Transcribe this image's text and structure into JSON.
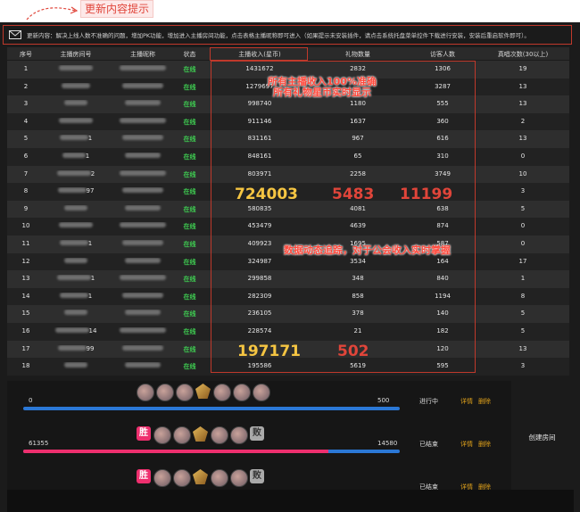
{
  "annotations": {
    "update_hint": "更新内容提示",
    "income_note_line1": "所有主播收入100%准确",
    "income_note_line2": "所有礼物星币实时显示",
    "data_note": "数据动态追踪，对于公会收入实时掌握"
  },
  "notice": {
    "text": "更新内容：解决上线人数不准确的问题，增加PK功能，增加进入主播房间功能，点击表格主播昵称即可进入（如果提示未安装插件，请点击系统托盘菜单控件下载进行安装，安装后重启软件即可）。"
  },
  "table": {
    "headers": [
      "序号",
      "主播房间号",
      "主播昵称",
      "状态",
      "主播收入(星币)",
      "礼物数量",
      "访客人数",
      "真唱次数(30以上)"
    ],
    "rows": [
      {
        "no": "1",
        "room": "",
        "nick": "",
        "status": "在线",
        "income": "1431672",
        "gifts": "2832",
        "visitors": "1306",
        "sing": "19"
      },
      {
        "no": "2",
        "room": "",
        "nick": "",
        "status": "在线",
        "income": "1279697",
        "gifts": "",
        "visitors": "3287",
        "sing": "13"
      },
      {
        "no": "3",
        "room": "",
        "nick": "",
        "status": "在线",
        "income": "998740",
        "gifts": "1180",
        "visitors": "555",
        "sing": "13"
      },
      {
        "no": "4",
        "room": "",
        "nick": "",
        "status": "在线",
        "income": "911146",
        "gifts": "1637",
        "visitors": "360",
        "sing": "2"
      },
      {
        "no": "5",
        "room": "1",
        "nick": "",
        "status": "在线",
        "income": "831161",
        "gifts": "967",
        "visitors": "616",
        "sing": "13"
      },
      {
        "no": "6",
        "room": "1",
        "nick": "",
        "status": "在线",
        "income": "848161",
        "gifts": "65",
        "visitors": "310",
        "sing": "0"
      },
      {
        "no": "7",
        "room": "2",
        "nick": "",
        "status": "在线",
        "income": "803971",
        "gifts": "2258",
        "visitors": "3749",
        "sing": "10"
      },
      {
        "no": "8",
        "room": "97",
        "nick": "",
        "status": "在线",
        "income": "",
        "gifts": "",
        "visitors": "",
        "sing": "3"
      },
      {
        "no": "9",
        "room": "",
        "nick": "",
        "status": "在线",
        "income": "580835",
        "gifts": "4081",
        "visitors": "638",
        "sing": "5"
      },
      {
        "no": "10",
        "room": "",
        "nick": "",
        "status": "在线",
        "income": "453479",
        "gifts": "4639",
        "visitors": "874",
        "sing": "0"
      },
      {
        "no": "11",
        "room": "1",
        "nick": "",
        "status": "在线",
        "income": "409923",
        "gifts": "1695",
        "visitors": "587",
        "sing": "0"
      },
      {
        "no": "12",
        "room": "",
        "nick": "",
        "status": "在线",
        "income": "324987",
        "gifts": "3534",
        "visitors": "164",
        "sing": "17"
      },
      {
        "no": "13",
        "room": "1",
        "nick": "",
        "status": "在线",
        "income": "299858",
        "gifts": "348",
        "visitors": "840",
        "sing": "1"
      },
      {
        "no": "14",
        "room": "1",
        "nick": "",
        "status": "在线",
        "income": "282309",
        "gifts": "858",
        "visitors": "1194",
        "sing": "8"
      },
      {
        "no": "15",
        "room": "",
        "nick": "",
        "status": "在线",
        "income": "236105",
        "gifts": "378",
        "visitors": "140",
        "sing": "5"
      },
      {
        "no": "16",
        "room": "14",
        "nick": "",
        "status": "在线",
        "income": "228574",
        "gifts": "21",
        "visitors": "182",
        "sing": "5"
      },
      {
        "no": "17",
        "room": "99",
        "nick": "",
        "status": "在线",
        "income": "",
        "gifts": "",
        "visitors": "120",
        "sing": "13"
      },
      {
        "no": "18",
        "room": "",
        "nick": "",
        "status": "在线",
        "income": "195586",
        "gifts": "5619",
        "visitors": "595",
        "sing": "3"
      }
    ],
    "highlight_row8": {
      "income": "724003",
      "gifts": "5483",
      "visitors": "11199"
    },
    "highlight_row17": {
      "income": "197171",
      "gifts": "502"
    }
  },
  "pk": [
    {
      "left": "0",
      "right": "500",
      "state": "进行中",
      "detail": "详情",
      "delete": "删除",
      "left_share": 0.0
    },
    {
      "left": "61355",
      "right": "14580",
      "state": "已结束",
      "detail": "详情",
      "delete": "删除",
      "left_share": 0.81
    },
    {
      "left": "",
      "right": "",
      "state": "已结束",
      "detail": "详情",
      "delete": "删除",
      "left_share": 0.5
    }
  ],
  "pk_badges": {
    "win": "胜",
    "lose": "败"
  },
  "buttons": {
    "create_room": "创建房间"
  },
  "colors": {
    "online": "#3fcf52",
    "annotation_red": "#ff4a3d",
    "gold": "#f5c542",
    "bar_blue": "#2b78d6",
    "bar_pink": "#ee2f6e"
  }
}
